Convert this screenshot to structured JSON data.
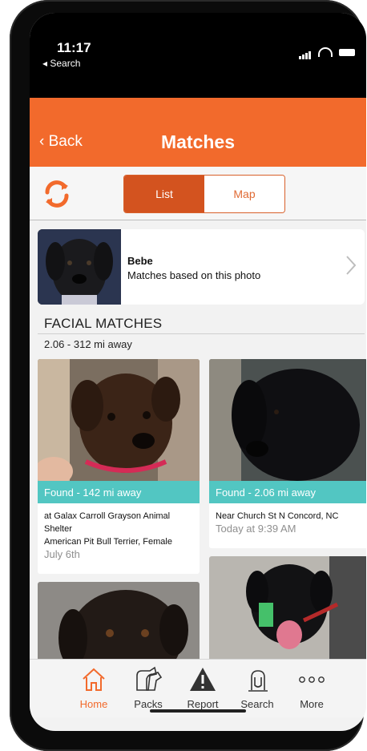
{
  "status_bar": {
    "time": "11:17",
    "back_app": "◂ Search"
  },
  "nav": {
    "back_label": "‹ Back",
    "title": "Matches"
  },
  "segmented": {
    "list_label": "List",
    "map_label": "Map",
    "selected": "List"
  },
  "pet": {
    "name": "Bebe",
    "subtitle": "Matches based on this photo"
  },
  "section": {
    "title": "FACIAL MATCHES",
    "distance_range": "2.06 - 312 mi away"
  },
  "matches": [
    {
      "found_label": "Found - 142 mi away",
      "line1": "at Galax Carroll Grayson Animal",
      "line2": "Shelter",
      "line3": "American Pit Bull Terrier, Female",
      "date": "July 6th"
    },
    {
      "found_label": "Found - 2.06 mi away",
      "line1": "Near Church St N Concord, NC",
      "date": "Today at 9:39 AM"
    }
  ],
  "tabs": [
    {
      "label": "Home",
      "icon": "home-icon",
      "active": true
    },
    {
      "label": "Packs",
      "icon": "packs-icon",
      "active": false
    },
    {
      "label": "Report",
      "icon": "warning-icon",
      "active": false
    },
    {
      "label": "Search",
      "icon": "search-dog-icon",
      "active": false
    },
    {
      "label": "More",
      "icon": "more-dots-icon",
      "active": false
    }
  ],
  "colors": {
    "accent": "#f26a2c",
    "found_banner": "#52c6c2",
    "segment_selected": "#d3531f"
  }
}
